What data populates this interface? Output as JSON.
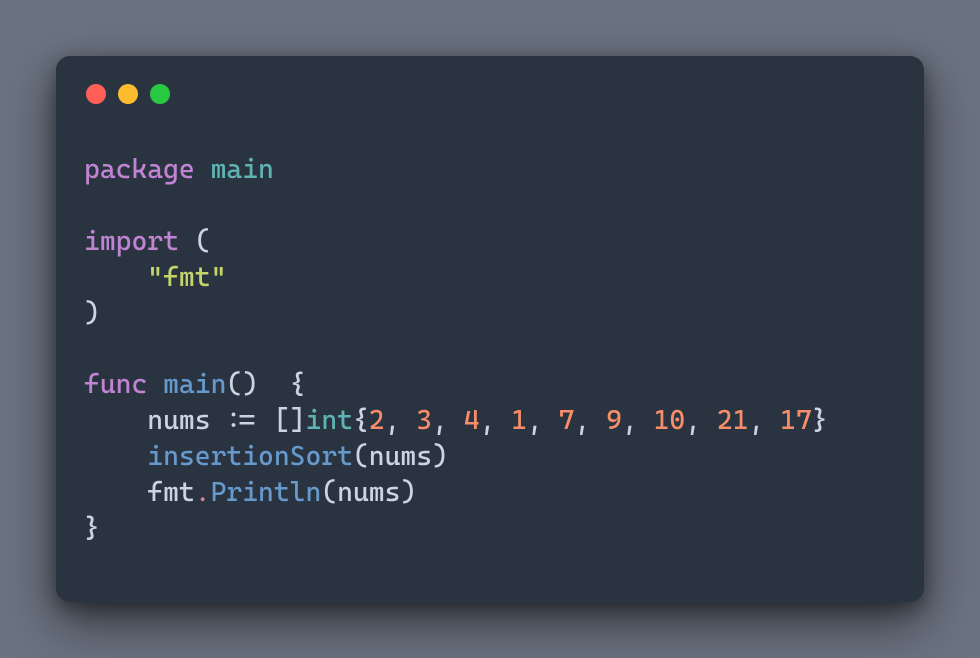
{
  "traffic": {
    "red": "red",
    "yellow": "yellow",
    "green": "green"
  },
  "code": {
    "line1": {
      "kw": "package",
      "sp": " ",
      "name": "main"
    },
    "line3": {
      "kw": "import",
      "sp": " ",
      "open": "("
    },
    "line4": {
      "indent": "    ",
      "str": "\"fmt\""
    },
    "line5": {
      "close": ")"
    },
    "line7": {
      "kw": "func",
      "sp1": " ",
      "name": "main",
      "parens": "()",
      "sp2": "  ",
      "brace": "{"
    },
    "line8": {
      "indent": "    ",
      "var": "nums",
      "sp1": " ",
      "assign": ":=",
      "sp2": " ",
      "lb": "[]",
      "type": "int",
      "ob": "{",
      "n1": "2",
      "c1": ", ",
      "n2": "3",
      "c2": ", ",
      "n3": "4",
      "c3": ", ",
      "n4": "1",
      "c4": ", ",
      "n5": "7",
      "c5": ", ",
      "n6": "9",
      "c6": ", ",
      "n7": "10",
      "c7": ", ",
      "n8": "21",
      "c8": ", ",
      "n9": "17",
      "cb": "}"
    },
    "line9": {
      "indent": "    ",
      "fn": "insertionSort",
      "open": "(",
      "arg": "nums",
      "close": ")"
    },
    "line10": {
      "indent": "    ",
      "pkg": "fmt",
      "dot": ".",
      "fn": "Println",
      "open": "(",
      "arg": "nums",
      "close": ")"
    },
    "line11": {
      "brace": "}"
    }
  }
}
